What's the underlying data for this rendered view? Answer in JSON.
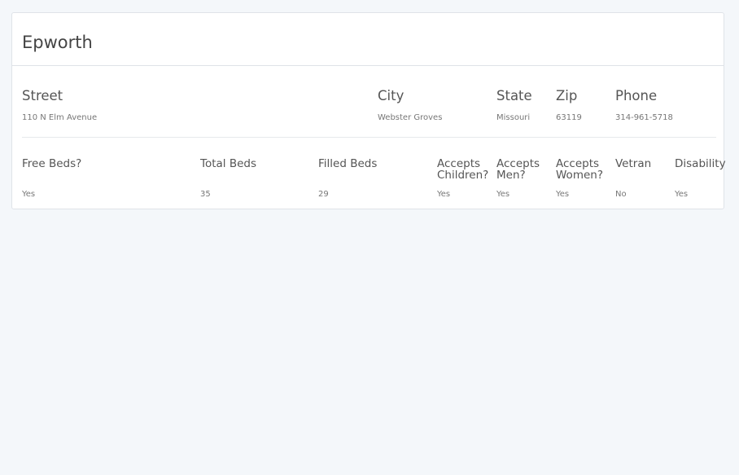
{
  "shelter": {
    "name": "Epworth"
  },
  "address": {
    "street_label": "Street",
    "street_value": "110 N Elm Avenue",
    "city_label": "City",
    "city_value": "Webster Groves",
    "state_label": "State",
    "state_value": "Missouri",
    "zip_label": "Zip",
    "zip_value": "63119",
    "phone_label": "Phone",
    "phone_value": "314-961-5718"
  },
  "details": {
    "free_beds_label": "Free Beds?",
    "free_beds_value": "Yes",
    "total_beds_label": "Total Beds",
    "total_beds_value": "35",
    "filled_beds_label": "Filled Beds",
    "filled_beds_value": "29",
    "accepts_children_label": "Accepts Children?",
    "accepts_children_value": "Yes",
    "accepts_men_label": "Accepts Men?",
    "accepts_men_value": "Yes",
    "accepts_women_label": "Accepts Women?",
    "accepts_women_value": "Yes",
    "vetran_label": "Vetran",
    "vetran_value": "No",
    "disability_label": "Disability",
    "disability_value": "Yes"
  }
}
